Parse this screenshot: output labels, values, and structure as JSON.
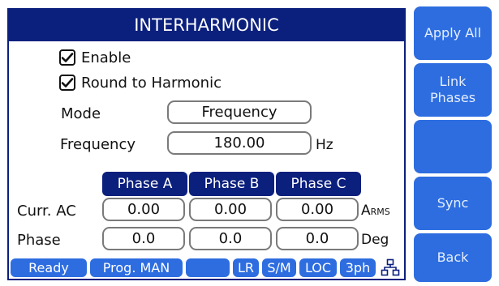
{
  "title": "INTERHARMONIC",
  "options": {
    "enable_label": "Enable",
    "round_label": "Round to Harmonic"
  },
  "mode": {
    "label": "Mode",
    "value": "Frequency"
  },
  "frequency": {
    "label": "Frequency",
    "value": "180.00",
    "unit": "Hz"
  },
  "phases": [
    "Phase A",
    "Phase B",
    "Phase C"
  ],
  "curr_ac": {
    "label": "Curr. AC",
    "values": [
      "0.00",
      "0.00",
      "0.00"
    ],
    "unit_main": "A",
    "unit_sub": "RMS"
  },
  "phase_row": {
    "label": "Phase",
    "values": [
      "0.0",
      "0.0",
      "0.0"
    ],
    "unit": "Deg"
  },
  "status": {
    "ready": "Ready",
    "prog": "Prog. MAN",
    "lr": "LR",
    "sm": "S/M",
    "loc": "LOC",
    "ph": "3ph"
  },
  "side_buttons": {
    "apply_all": "Apply All",
    "link_phases": "Link\nPhases",
    "blank": "",
    "sync": "Sync",
    "back": "Back"
  },
  "colors": {
    "title_bg": "#0b1f7d",
    "button_bg": "#2d6de0"
  },
  "icons": {
    "checkbox": "checkmark-icon",
    "network": "network-icon"
  }
}
